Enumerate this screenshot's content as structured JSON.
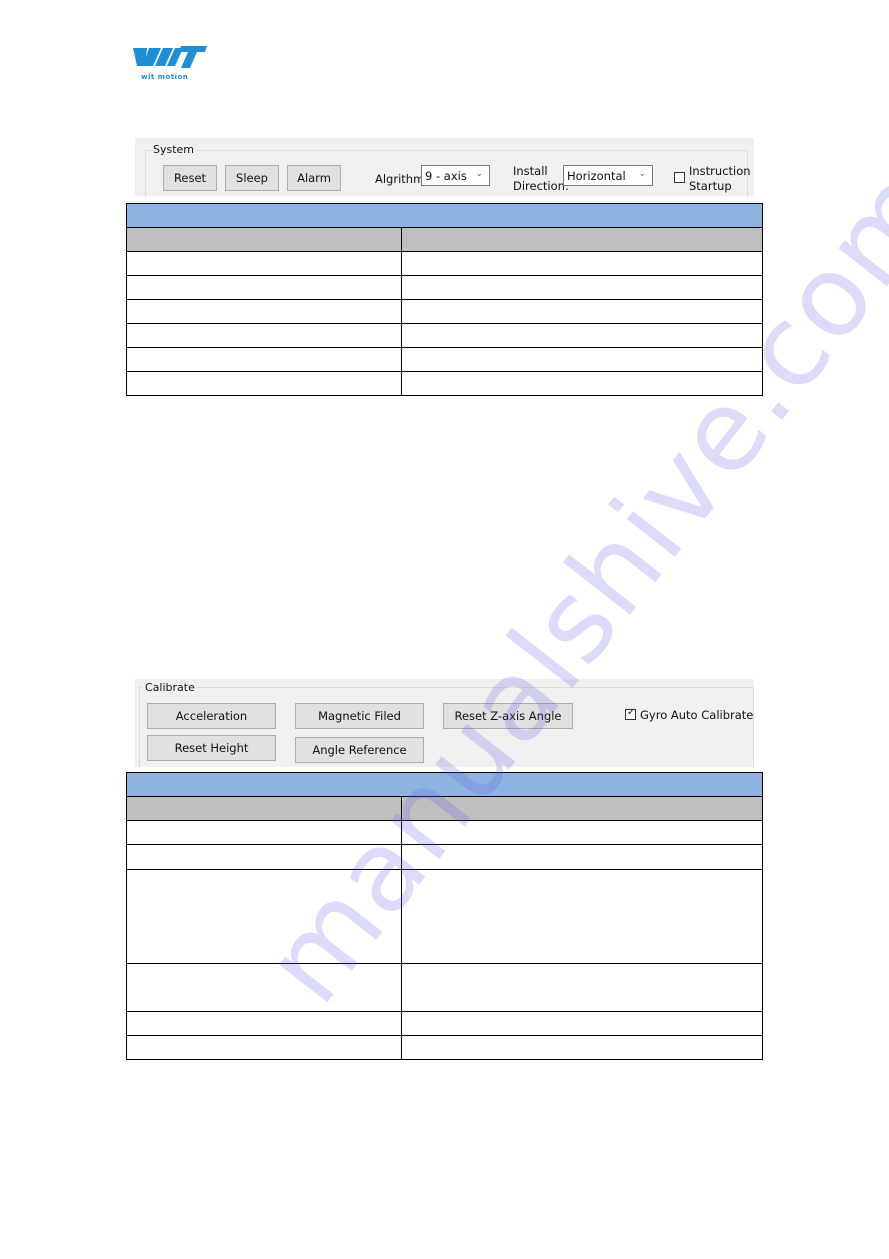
{
  "logo": {
    "brand": "WIT",
    "subtitle": "wit motion",
    "color": "#1e8fd6"
  },
  "system_panel": {
    "group_label": "System",
    "buttons": [
      {
        "label": "Reset"
      },
      {
        "label": "Sleep"
      },
      {
        "label": "Alarm"
      }
    ],
    "algorithm": {
      "label": "Algrithm:",
      "value": "9 - axis"
    },
    "install_direction": {
      "label_line1": "Install",
      "label_line2": "Direction:",
      "value": "Horizontal"
    },
    "instruction_startup": {
      "label_line1": "Instruction",
      "label_line2": "Startup",
      "checked": false
    }
  },
  "system_table": {
    "title": "",
    "headers": [
      "",
      ""
    ],
    "rows": [
      [
        "",
        ""
      ],
      [
        "",
        ""
      ],
      [
        "",
        ""
      ],
      [
        "",
        ""
      ],
      [
        "",
        ""
      ],
      [
        "",
        ""
      ]
    ]
  },
  "calibrate_panel": {
    "group_label": "Calibrate",
    "buttons": [
      {
        "label": "Acceleration"
      },
      {
        "label": "Magnetic Filed"
      },
      {
        "label": "Reset Z-axis Angle"
      },
      {
        "label": "Reset Height"
      },
      {
        "label": "Angle Reference"
      }
    ],
    "gyro_auto_calibrate": {
      "label": "Gyro Auto Calibrate",
      "checked": true
    }
  },
  "calibrate_table": {
    "title": "",
    "headers": [
      "",
      ""
    ],
    "rows": [
      [
        "",
        ""
      ],
      [
        "",
        ""
      ],
      [
        "",
        ""
      ],
      [
        "",
        ""
      ],
      [
        "",
        ""
      ],
      [
        "",
        ""
      ]
    ]
  },
  "colors": {
    "table_title_bg": "#8db3e2",
    "table_header_bg": "#bfbfbf",
    "panel_bg": "#f0f0f0"
  },
  "watermark": {
    "text": "manualshive.com"
  }
}
